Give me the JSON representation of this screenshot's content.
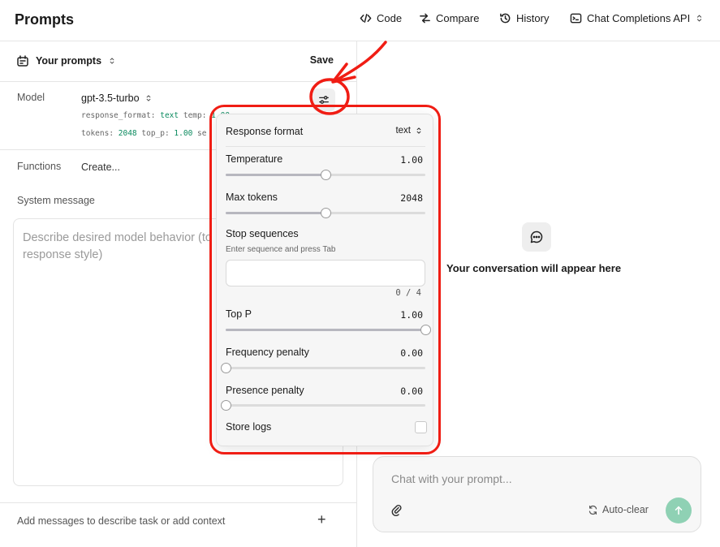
{
  "header": {
    "title": "Prompts",
    "code_label": "Code",
    "compare_label": "Compare",
    "history_label": "History",
    "api_label": "Chat Completions API"
  },
  "left": {
    "your_prompts_label": "Your prompts",
    "save_label": "Save",
    "model_label": "Model",
    "model_value": "gpt-3.5-turbo",
    "params_line1_prefix": "response_format: ",
    "params_line1_value": "text",
    "params_line1_suffix": " temp: ",
    "params_line1_temp": "1.00",
    "params_line2_prefix": "tokens: ",
    "params_line2_tokens": "2048",
    "params_line2_mid": " top_p: ",
    "params_line2_topp": "1.00",
    "params_line2_suffix": " se",
    "functions_label": "Functions",
    "functions_create": "Create...",
    "system_message_label": "System message",
    "system_message_placeholder_line1": "Describe desired model behavior (to",
    "system_message_placeholder_line2": "response style)",
    "add_messages_label": "Add messages to describe task or add context"
  },
  "right": {
    "empty_state_text": "Your conversation will appear here",
    "chat_placeholder": "Chat with your prompt...",
    "autoclear_label": "Auto-clear"
  },
  "settings": {
    "response_format_label": "Response format",
    "response_format_value": "text",
    "temperature_label": "Temperature",
    "temperature_value": "1.00",
    "temperature_fraction": 0.5,
    "max_tokens_label": "Max tokens",
    "max_tokens_value": "2048",
    "max_tokens_fraction": 0.5,
    "stop_sequences_label": "Stop sequences",
    "stop_sequences_hint": "Enter sequence and press Tab",
    "stop_sequences_count": "0 / 4",
    "top_p_label": "Top P",
    "top_p_value": "1.00",
    "top_p_fraction": 1.0,
    "frequency_penalty_label": "Frequency penalty",
    "frequency_penalty_value": "0.00",
    "frequency_penalty_fraction": 0.0,
    "presence_penalty_label": "Presence penalty",
    "presence_penalty_value": "0.00",
    "presence_penalty_fraction": 0.0,
    "store_logs_label": "Store logs",
    "store_logs_checked": false
  },
  "colors": {
    "annotation_red": "#f01d14",
    "param_green": "#0a8a5e",
    "send_button": "#8fd1b4"
  }
}
